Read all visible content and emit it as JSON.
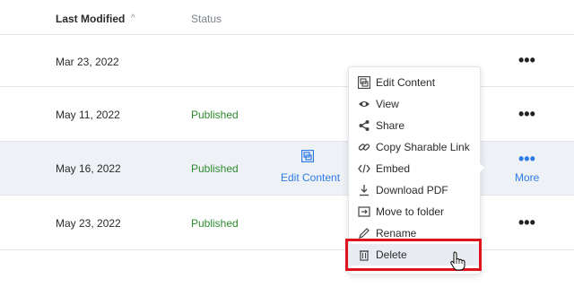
{
  "table": {
    "headers": {
      "last_modified": "Last Modified",
      "status": "Status"
    },
    "rows": [
      {
        "date": "Mar 23, 2022",
        "status": ""
      },
      {
        "date": "May 11, 2022",
        "status": "Published"
      },
      {
        "date": "May 16, 2022",
        "status": "Published"
      },
      {
        "date": "May 23, 2022",
        "status": "Published"
      }
    ],
    "more_dots": "•••",
    "more_label": "More",
    "edit_content_label": "Edit Content"
  },
  "context_menu": {
    "items": [
      {
        "label": "Edit Content",
        "icon": "edit-content-icon"
      },
      {
        "label": "View",
        "icon": "eye-icon"
      },
      {
        "label": "Share",
        "icon": "share-icon"
      },
      {
        "label": "Copy Sharable Link",
        "icon": "link-icon"
      },
      {
        "label": "Embed",
        "icon": "code-icon"
      },
      {
        "label": "Download PDF",
        "icon": "download-icon"
      },
      {
        "label": "Move to folder",
        "icon": "move-folder-icon"
      },
      {
        "label": "Rename",
        "icon": "pencil-icon"
      },
      {
        "label": "Delete",
        "icon": "trash-icon"
      }
    ]
  },
  "colors": {
    "accent": "#2d7be5",
    "published": "#2e8b2e",
    "highlight_box": "#e0121e"
  }
}
